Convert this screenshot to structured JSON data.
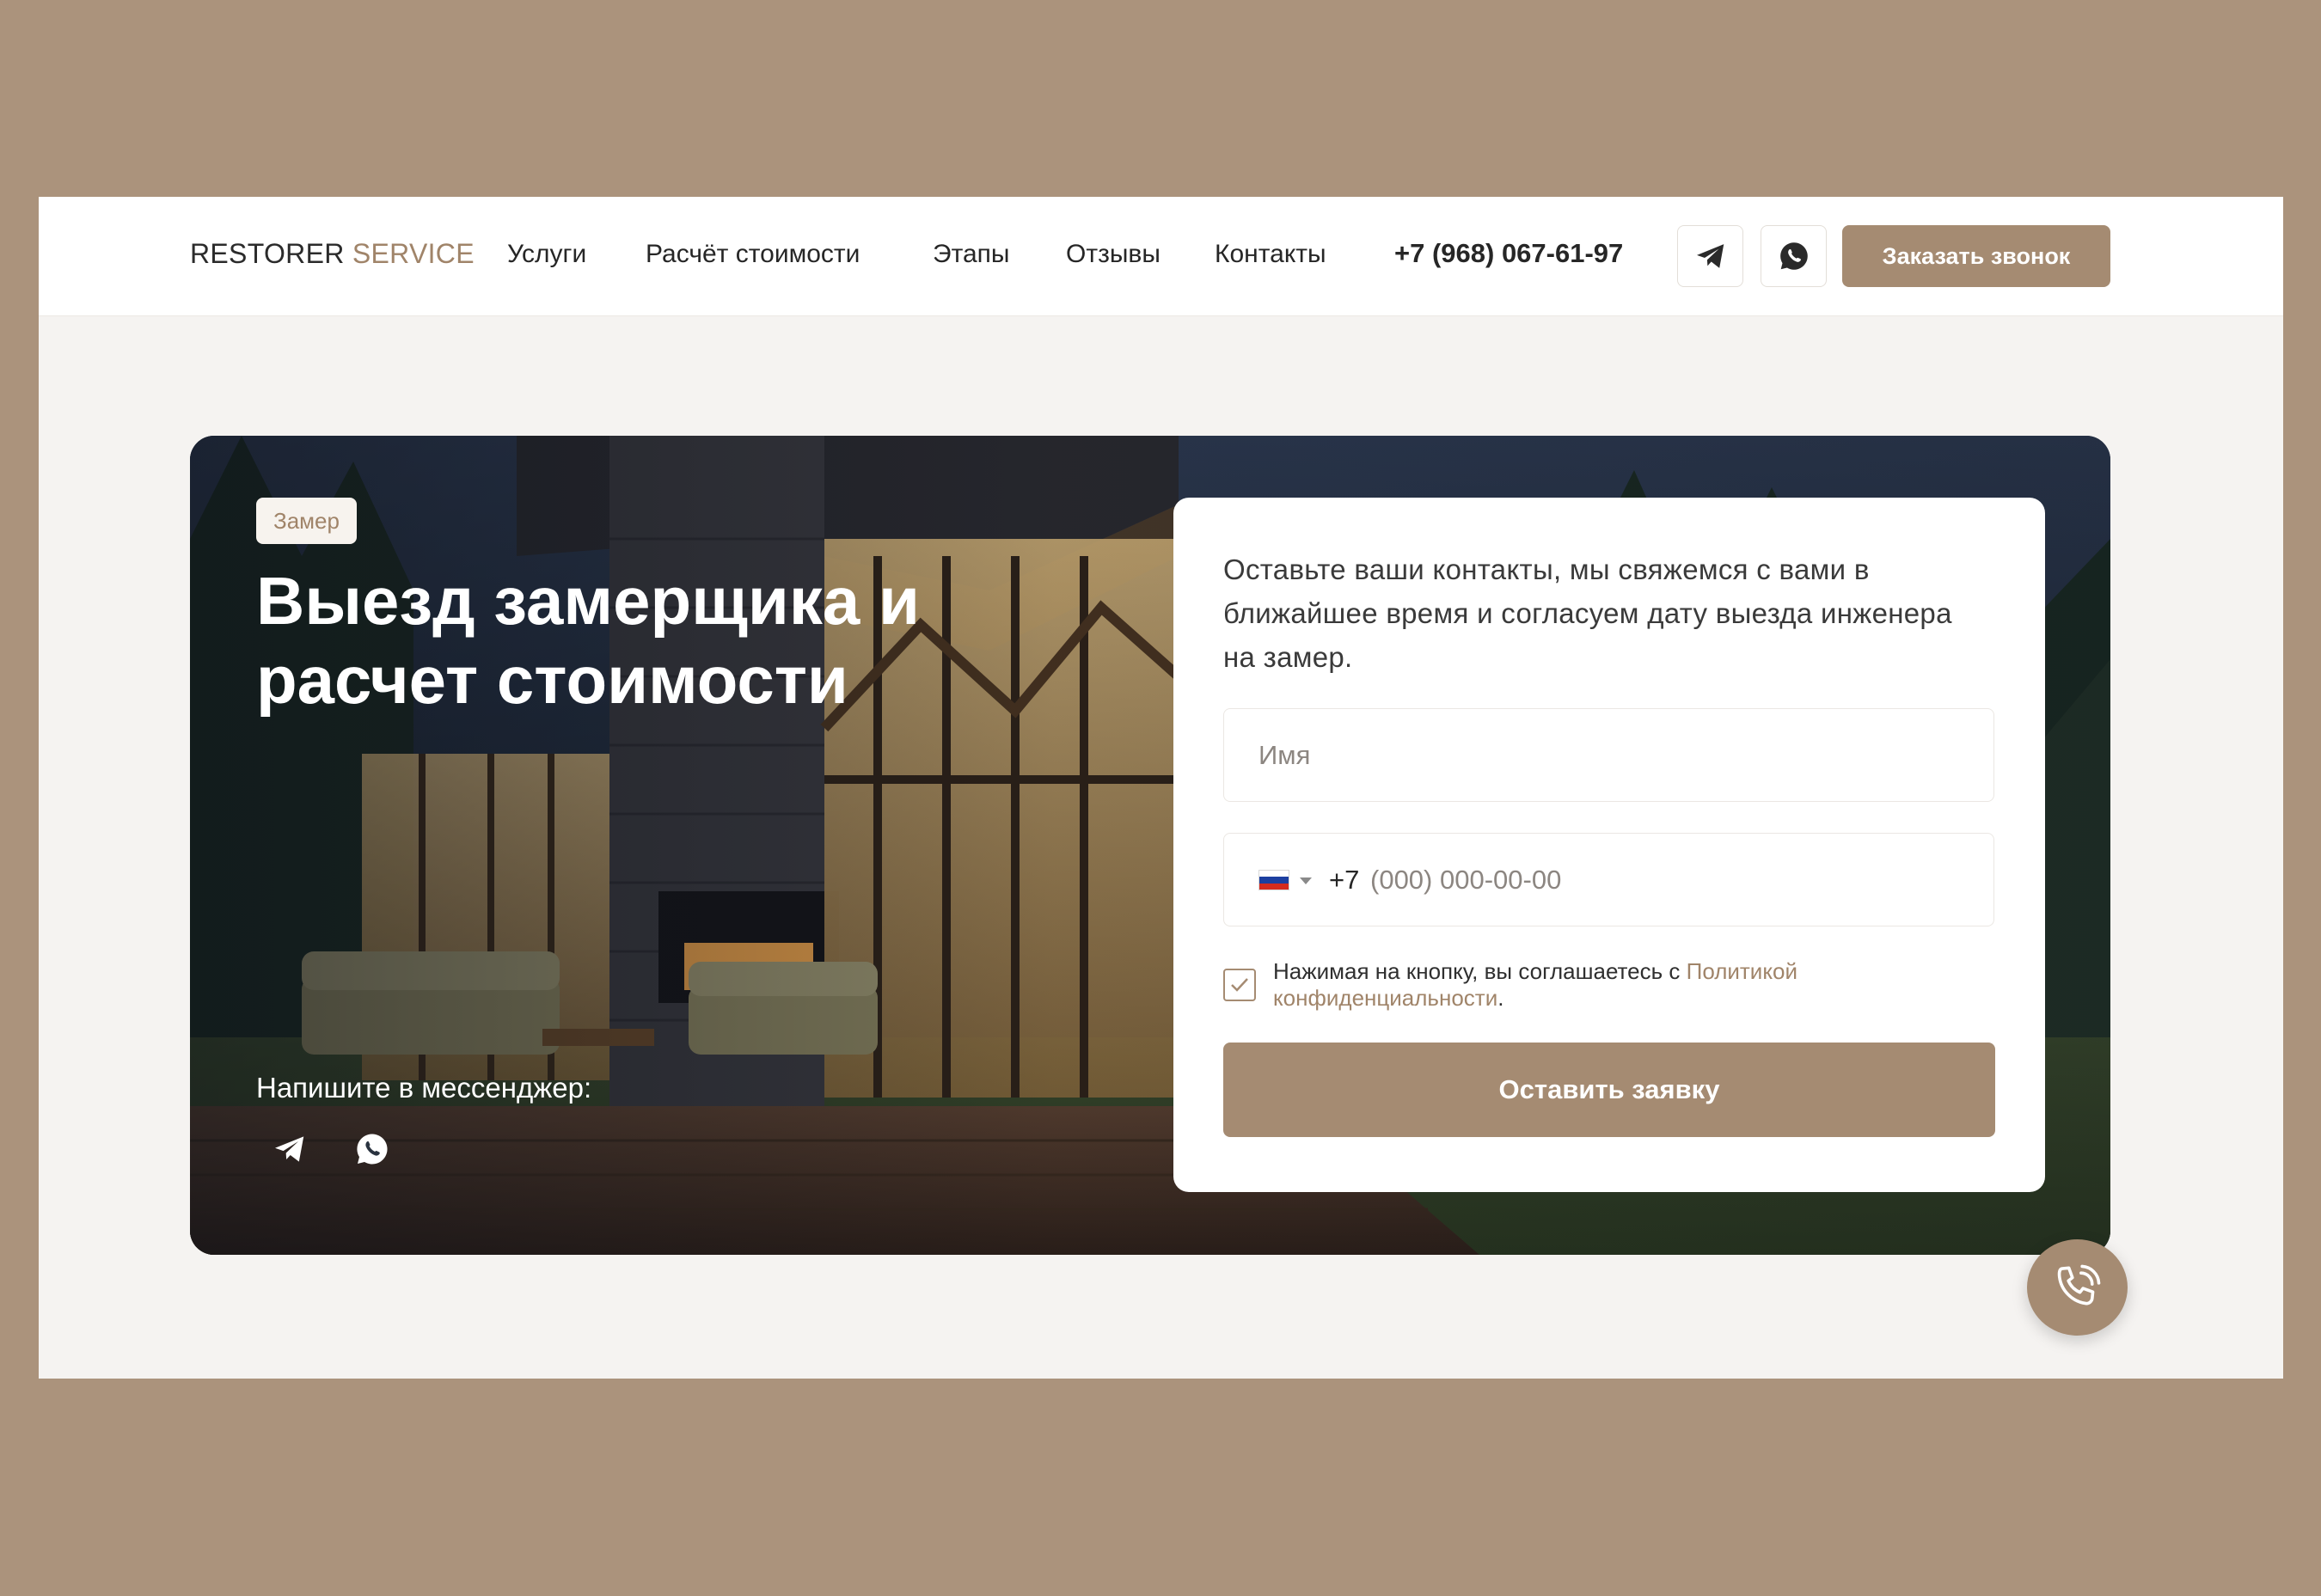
{
  "header": {
    "logo_part1": "RESTORER",
    "logo_part2": "SERVICE",
    "nav": [
      {
        "label": "Услуги"
      },
      {
        "label": "Расчёт стоимости"
      },
      {
        "label": "Этапы"
      },
      {
        "label": "Отзывы"
      },
      {
        "label": "Контакты"
      }
    ],
    "phone": "+7 (968) 067-61-97",
    "icons": [
      "telegram-icon",
      "whatsapp-icon"
    ],
    "cta_label": "Заказать звонок"
  },
  "hero": {
    "badge": "Замер",
    "title": "Выезд замерщика и расчет стоимости",
    "messenger_label": "Напишите в мессенджер:",
    "messenger_icons": [
      "telegram-icon",
      "whatsapp-icon"
    ]
  },
  "form": {
    "intro": "Оставьте ваши контакты, мы свяжемся с вами в ближайшее время и согласуем дату выезда инженера на замер.",
    "name_placeholder": "Имя",
    "phone_prefix": "+7",
    "phone_placeholder": "(000) 000-00-00",
    "country_flag": "russia-flag-icon",
    "consent_checked": true,
    "consent_text": "Нажимая на кнопку, вы соглашаетесь с ",
    "consent_link": "Политикой конфиденциальности",
    "consent_end": ".",
    "submit_label": "Оставить заявку"
  },
  "floating": {
    "icon": "phone-call-icon"
  },
  "colors": {
    "page_bg": "#ab937c",
    "accent": "#a58b72",
    "accent_text": "#a08469",
    "content_bg": "#f5f3f1"
  }
}
